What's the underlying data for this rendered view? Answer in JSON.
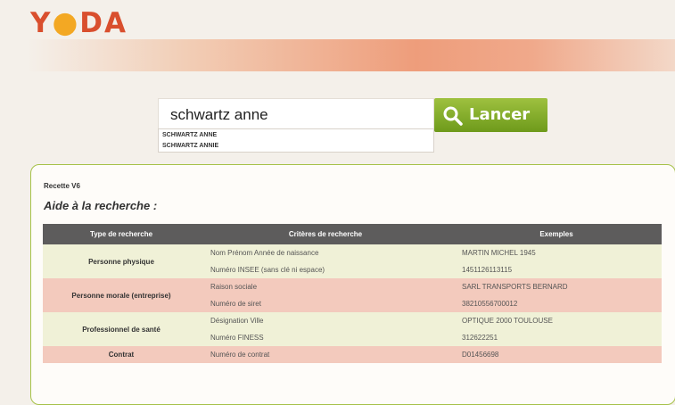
{
  "logo": {
    "text": "YODA"
  },
  "search": {
    "value": "schwartz anne",
    "suggestions": [
      "SCHWARTZ ANNE",
      "SCHWARTZ ANNIE"
    ],
    "button_label": "Lancer"
  },
  "panel": {
    "recette": "Recette V6",
    "aide_title": "Aide à la recherche :"
  },
  "table": {
    "headers": [
      "Type de recherche",
      "Critères de recherche",
      "Exemples"
    ],
    "rows": [
      {
        "type": "Personne physique",
        "criteria": [
          "Nom Prénom Année de naissance",
          "Numéro INSEE (sans clé ni espace)"
        ],
        "examples": [
          "MARTIN MICHEL 1945",
          "1451126113115"
        ]
      },
      {
        "type": "Personne morale (entreprise)",
        "criteria": [
          "Raison sociale",
          "Numéro de siret"
        ],
        "examples": [
          "SARL TRANSPORTS BERNARD",
          "38210556700012"
        ]
      },
      {
        "type": "Professionnel de santé",
        "criteria": [
          "Désignation Ville",
          "Numéro FINESS"
        ],
        "examples": [
          "OPTIQUE 2000 TOULOUSE",
          "312622251"
        ]
      },
      {
        "type": "Contrat",
        "criteria": [
          "Numéro de contrat"
        ],
        "examples": [
          "D01456698"
        ]
      }
    ]
  },
  "colors": {
    "accent_green": "#8ab22e",
    "logo_red": "#d94f2e",
    "logo_yellow": "#f3a823",
    "row_green": "#f0f1d7",
    "row_pink": "#f3cabd",
    "header_gray": "#5d5c5c"
  }
}
